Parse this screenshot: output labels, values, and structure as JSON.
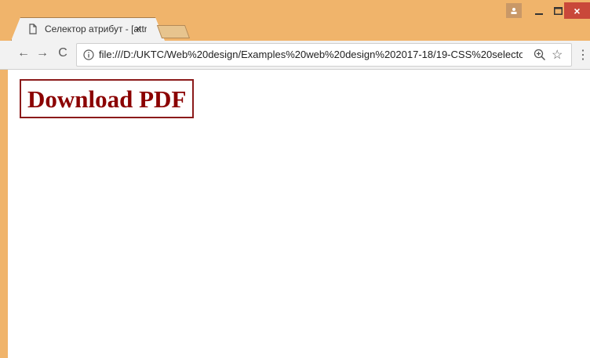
{
  "tab": {
    "title": "Селектор атрибут - [attr",
    "close": "×"
  },
  "toolbar": {
    "back": "←",
    "forward": "→",
    "reload": "C",
    "url": "file:///D:/UKTC/Web%20design/Examples%20web%20design%202017-18/19-CSS%20selectors/...",
    "star": "☆",
    "menu": "⋮"
  },
  "window": {
    "close": "×"
  },
  "page": {
    "link_label": "Download PDF"
  }
}
